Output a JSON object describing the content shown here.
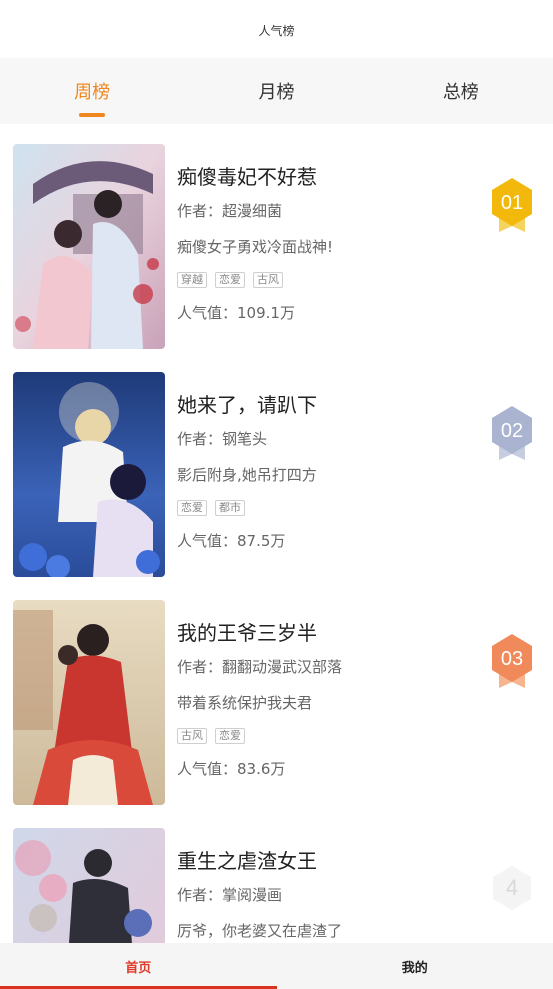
{
  "header": {
    "title": "人气榜"
  },
  "tabs": [
    {
      "label": "周榜",
      "active": true
    },
    {
      "label": "月榜",
      "active": false
    },
    {
      "label": "总榜",
      "active": false
    }
  ],
  "items": [
    {
      "name": "痴傻毒妃不好惹",
      "author": "作者：超漫细菌",
      "desc": "痴傻女子勇戏冷面战神!",
      "tags": [
        "穿越",
        "恋爱",
        "古风"
      ],
      "popularity": "人气值：109.1万",
      "rank": "01",
      "rank_color": "#f2b90c"
    },
    {
      "name": "她来了，请趴下",
      "author": "作者：钢笔头",
      "desc": "影后附身,她吊打四方",
      "tags": [
        "恋爱",
        "都市"
      ],
      "popularity": "人气值：87.5万",
      "rank": "02",
      "rank_color": "#aab3cf"
    },
    {
      "name": "我的王爷三岁半",
      "author": "作者：翻翻动漫武汉部落",
      "desc": "带着系统保护我夫君",
      "tags": [
        "古风",
        "恋爱"
      ],
      "popularity": "人气值：83.6万",
      "rank": "03",
      "rank_color": "#f08a5a"
    },
    {
      "name": "重生之虐渣女王",
      "author": "作者：掌阅漫画",
      "desc": "厉爷，你老婆又在虐渣了",
      "tags": [],
      "popularity": "",
      "rank": "4",
      "rank_color": "#d9d9d9"
    }
  ],
  "bottom_nav": [
    {
      "label": "首页",
      "active": true
    },
    {
      "label": "我的",
      "active": false
    }
  ],
  "colors": {
    "accent": "#f0871e",
    "nav_active": "#e03a2a"
  }
}
